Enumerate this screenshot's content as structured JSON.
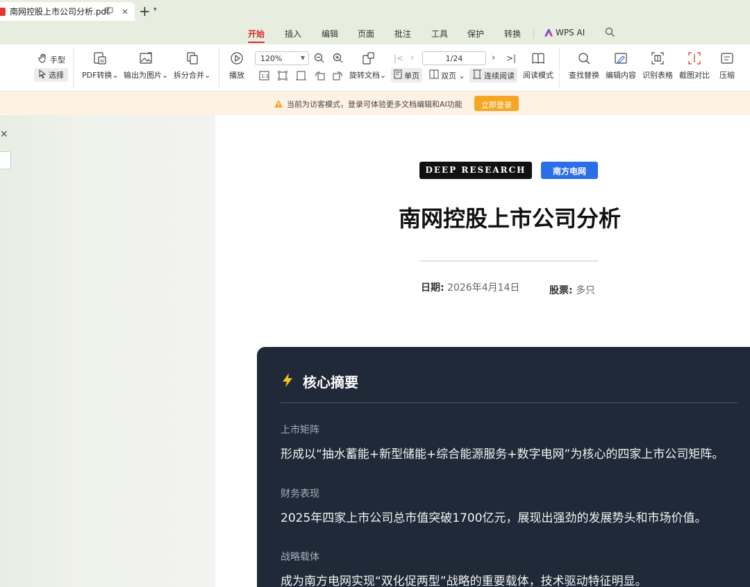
{
  "tab": {
    "title": "南网控股上市公司分析.pdf"
  },
  "menu": {
    "items": [
      "开始",
      "插入",
      "编辑",
      "页面",
      "批注",
      "工具",
      "保护",
      "转换"
    ],
    "active": "开始",
    "ai_label": "WPS AI"
  },
  "toolbar": {
    "hand": "手型",
    "select": "选择",
    "pdf_convert": "PDF转换",
    "export_image": "输出为图片",
    "split_merge": "拆分合并",
    "play": "播放",
    "zoom": "120%",
    "rotate": "旋转文档",
    "single": "单页",
    "double": "双页",
    "continuous": "连续阅读",
    "page": "1/24",
    "read_mode": "阅读模式",
    "find_replace": "查找替换",
    "edit_content": "编辑内容",
    "recognize_table": "识别表格",
    "screenshot_compare": "截图对比",
    "compress": "压缩"
  },
  "notice": {
    "text": "当前为访客模式，登录可体验更多文档编辑和AI功能",
    "login": "立即登录"
  },
  "doc": {
    "badge_left": "DEEP RESEARCH",
    "badge_right": "南方电网",
    "title": "南网控股上市公司分析",
    "date_label": "日期:",
    "date_value": "2026年4月14日",
    "stock_label": "股票:",
    "stock_value": "多只",
    "summary": {
      "heading": "核心摘要",
      "items": [
        {
          "label": "上市矩阵",
          "text": "形成以“抽水蓄能+新型储能+综合能源服务+数字电网”为核心的四家上市公司矩阵。"
        },
        {
          "label": "财务表现",
          "text": "2025年四家上市公司总市值突破1700亿元，展现出强劲的发展势头和市场价值。"
        },
        {
          "label": "战略载体",
          "text": "成为南方电网实现“双化促两型”战略的重要载体，技术驱动特征明显。"
        }
      ]
    }
  },
  "colors": {
    "accent": "#d2302b",
    "summary_bg": "#1f2937",
    "badge_blue": "#2b6ee8",
    "login": "#f5a623"
  }
}
